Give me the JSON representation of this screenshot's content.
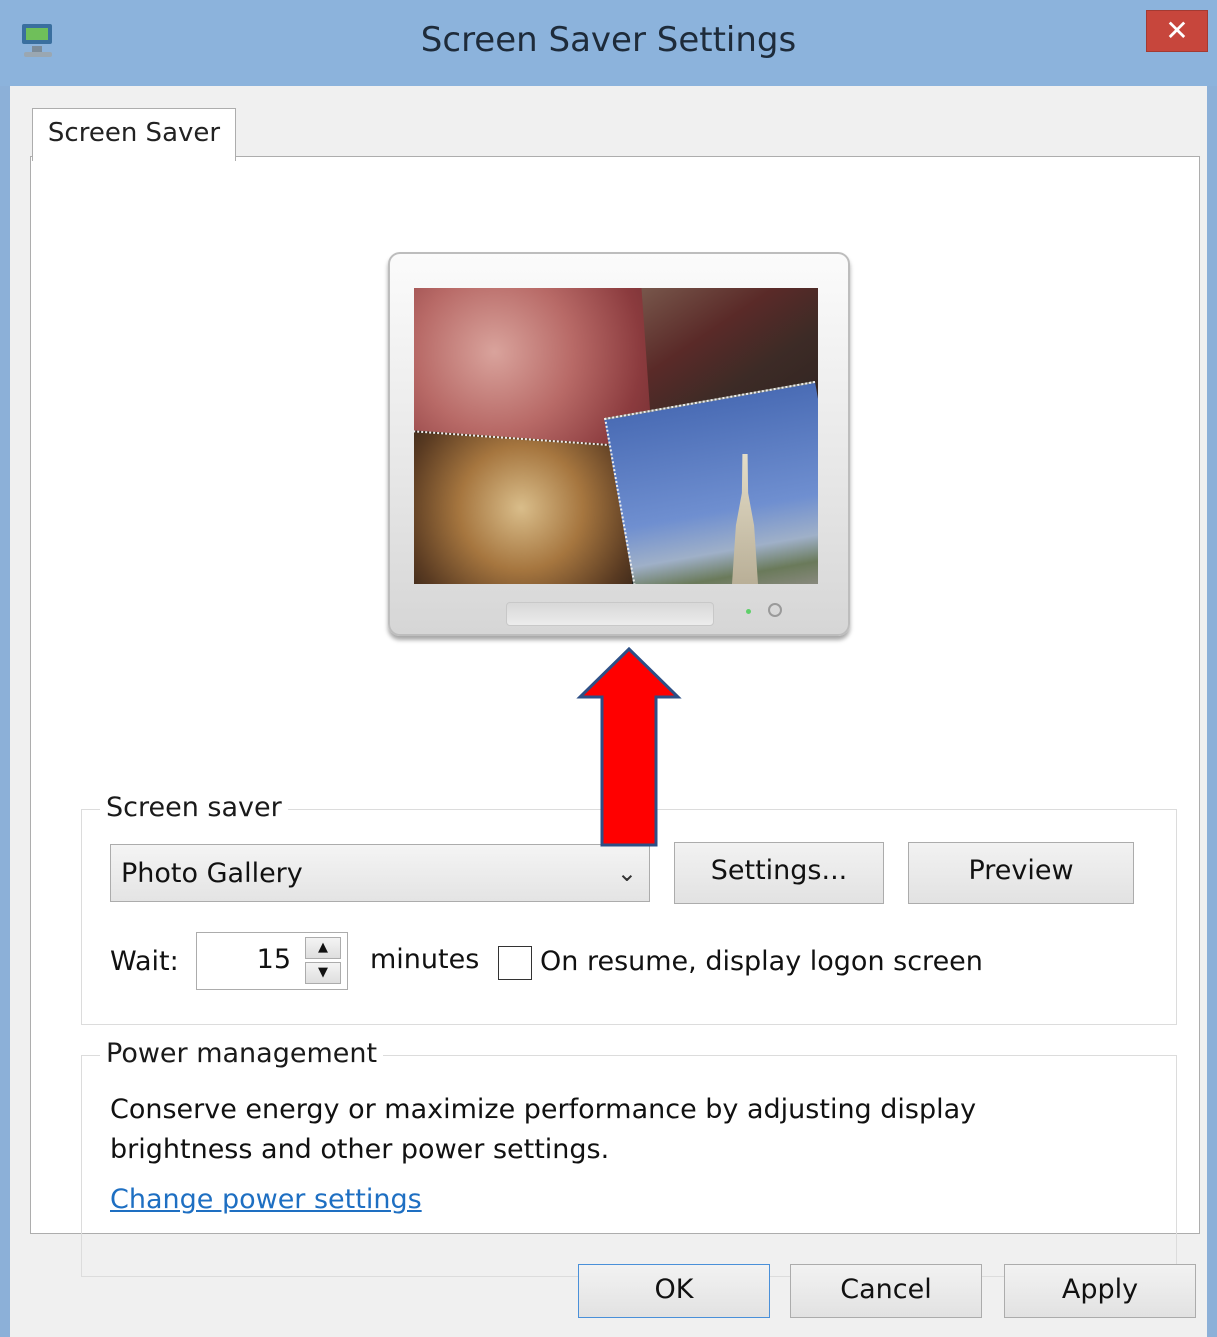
{
  "window": {
    "title": "Screen Saver Settings",
    "close_icon": "✕"
  },
  "tabs": [
    {
      "label": "Screen Saver",
      "selected": true
    }
  ],
  "screensaver_group": {
    "legend": "Screen saver",
    "selected": "Photo Gallery",
    "settings_button": "Settings...",
    "preview_button": "Preview",
    "wait_label": "Wait:",
    "wait_value": "15",
    "minutes_label": "minutes",
    "resume_checkbox_checked": false,
    "resume_label": "On resume, display logon screen"
  },
  "power_group": {
    "legend": "Power management",
    "description": "Conserve energy or maximize performance by adjusting display brightness and other power settings.",
    "link": "Change power settings"
  },
  "footer": {
    "ok": "OK",
    "cancel": "Cancel",
    "apply": "Apply"
  },
  "colors": {
    "titlebar": "#8cb3dc",
    "close_button": "#c7463c",
    "link": "#1e6fc2",
    "annotation_arrow": "#ff0000"
  },
  "icons": [
    "app-icon",
    "close-icon",
    "chevron-down-icon",
    "spin-up-icon",
    "spin-down-icon"
  ]
}
